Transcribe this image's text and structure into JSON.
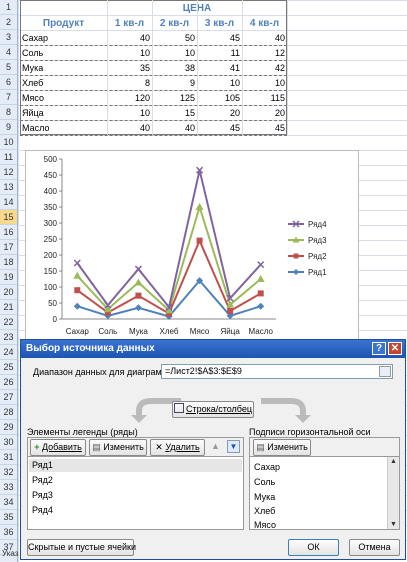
{
  "sheet": {
    "row_numbers": [
      "1",
      "2",
      "3",
      "4",
      "5",
      "6",
      "7",
      "8",
      "9",
      "10",
      "11",
      "12",
      "13",
      "14",
      "15",
      "16",
      "17",
      "18",
      "19",
      "20",
      "21",
      "22",
      "23",
      "24",
      "25",
      "26",
      "27",
      "28",
      "29",
      "30",
      "31",
      "32",
      "33",
      "34",
      "35",
      "36",
      "37"
    ],
    "header_group": "ЦЕНА",
    "col_product": "Продукт",
    "col_q": [
      "1 кв-л",
      "2 кв-л",
      "3 кв-л",
      "4 кв-л"
    ],
    "rows": [
      {
        "name": "Сахар",
        "v": [
          "40",
          "50",
          "45",
          "40"
        ]
      },
      {
        "name": "Соль",
        "v": [
          "10",
          "10",
          "11",
          "12"
        ]
      },
      {
        "name": "Мука",
        "v": [
          "35",
          "38",
          "41",
          "42"
        ]
      },
      {
        "name": "Хлеб",
        "v": [
          "8",
          "9",
          "10",
          "10"
        ]
      },
      {
        "name": "Мясо",
        "v": [
          "120",
          "125",
          "105",
          "115"
        ]
      },
      {
        "name": "Яйца",
        "v": [
          "10",
          "15",
          "20",
          "20"
        ]
      },
      {
        "name": "Масло",
        "v": [
          "40",
          "40",
          "45",
          "45"
        ]
      }
    ],
    "bottom_tab": "Указ"
  },
  "chart_data": {
    "type": "line",
    "categories": [
      "Сахар",
      "Соль",
      "Мука",
      "Хлеб",
      "Мясо",
      "Яйца",
      "Масло"
    ],
    "y_ticks": [
      "0",
      "50",
      "100",
      "150",
      "200",
      "250",
      "300",
      "350",
      "400",
      "450",
      "500"
    ],
    "ylim": [
      0,
      500
    ],
    "stacked": true,
    "legend_position": "right",
    "series": [
      {
        "name": "Ряд1",
        "color": "#4f81bd",
        "marker": "diamond",
        "values": [
          40,
          10,
          35,
          8,
          120,
          10,
          40
        ]
      },
      {
        "name": "Ряд2",
        "color": "#c0504d",
        "marker": "square",
        "values": [
          50,
          10,
          38,
          9,
          125,
          15,
          40
        ]
      },
      {
        "name": "Ряд3",
        "color": "#9bbb59",
        "marker": "triangle",
        "values": [
          45,
          11,
          41,
          10,
          105,
          20,
          45
        ]
      },
      {
        "name": "Ряд4",
        "color": "#8064a2",
        "marker": "x",
        "values": [
          40,
          12,
          42,
          10,
          115,
          20,
          45
        ]
      }
    ]
  },
  "dialog": {
    "title": "Выбор источника данных",
    "range_label": "Диапазон данных для диаграммы:",
    "range_value": "=Лист2!$A$3:$E$9",
    "switch_label": "Строка/столбец",
    "legend_label": "Элементы легенды (ряды)",
    "axis_label": "Подписи горизонтальной оси (категории)",
    "add_label": "Добавить",
    "edit_label": "Изменить",
    "delete_label": "Удалить",
    "edit2_label": "Изменить",
    "series_items": [
      "Ряд1",
      "Ряд2",
      "Ряд3",
      "Ряд4"
    ],
    "category_items": [
      "Сахар",
      "Соль",
      "Мука",
      "Хлеб",
      "Мясо"
    ],
    "hidden_cells_label": "Скрытые и пустые ячейки",
    "ok_label": "ОК",
    "cancel_label": "Отмена",
    "help_glyph": "?",
    "close_glyph": "✕"
  }
}
